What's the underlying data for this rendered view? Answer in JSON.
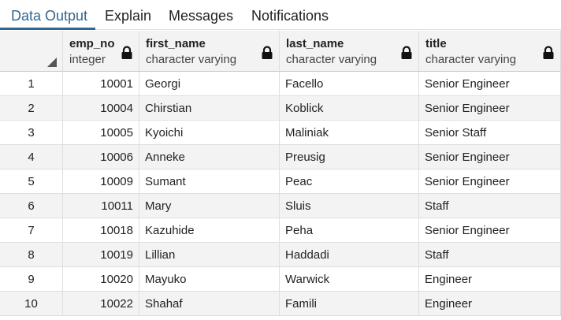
{
  "tabs": [
    {
      "label": "Data Output",
      "active": true
    },
    {
      "label": "Explain",
      "active": false
    },
    {
      "label": "Messages",
      "active": false
    },
    {
      "label": "Notifications",
      "active": false
    }
  ],
  "accent_color": "#326690",
  "columns": [
    {
      "name": "emp_no",
      "type": "integer",
      "icon": "lock-icon"
    },
    {
      "name": "first_name",
      "type": "character varying",
      "icon": "lock-icon"
    },
    {
      "name": "last_name",
      "type": "character varying",
      "icon": "lock-icon"
    },
    {
      "name": "title",
      "type": "character varying",
      "icon": "lock-icon"
    }
  ],
  "rows": [
    {
      "index": "1",
      "emp_no": "10001",
      "first_name": "Georgi",
      "last_name": "Facello",
      "title": "Senior Engineer"
    },
    {
      "index": "2",
      "emp_no": "10004",
      "first_name": "Chirstian",
      "last_name": "Koblick",
      "title": "Senior Engineer"
    },
    {
      "index": "3",
      "emp_no": "10005",
      "first_name": "Kyoichi",
      "last_name": "Maliniak",
      "title": "Senior Staff"
    },
    {
      "index": "4",
      "emp_no": "10006",
      "first_name": "Anneke",
      "last_name": "Preusig",
      "title": "Senior Engineer"
    },
    {
      "index": "5",
      "emp_no": "10009",
      "first_name": "Sumant",
      "last_name": "Peac",
      "title": "Senior Engineer"
    },
    {
      "index": "6",
      "emp_no": "10011",
      "first_name": "Mary",
      "last_name": "Sluis",
      "title": "Staff"
    },
    {
      "index": "7",
      "emp_no": "10018",
      "first_name": "Kazuhide",
      "last_name": "Peha",
      "title": "Senior Engineer"
    },
    {
      "index": "8",
      "emp_no": "10019",
      "first_name": "Lillian",
      "last_name": "Haddadi",
      "title": "Staff"
    },
    {
      "index": "9",
      "emp_no": "10020",
      "first_name": "Mayuko",
      "last_name": "Warwick",
      "title": "Engineer"
    },
    {
      "index": "10",
      "emp_no": "10022",
      "first_name": "Shahaf",
      "last_name": "Famili",
      "title": "Engineer"
    }
  ]
}
